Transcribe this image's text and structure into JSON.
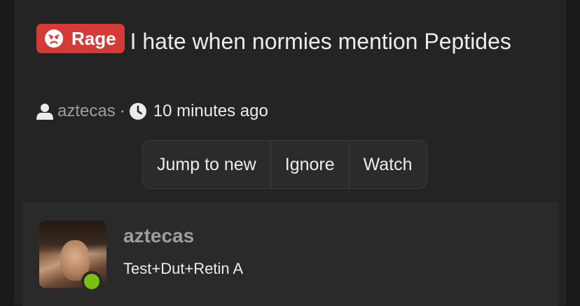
{
  "thread": {
    "prefix_label": "Rage",
    "title": "I hate when normies mention Peptides",
    "author": "aztecas",
    "separator": "·",
    "time": "10 minutes ago"
  },
  "actions": {
    "jump_label": "Jump to new",
    "ignore_label": "Ignore",
    "watch_label": "Watch"
  },
  "post": {
    "username": "aztecas",
    "user_title": "Test+Dut+Retin A",
    "online": true
  },
  "colors": {
    "prefix_badge": "#d53b36",
    "online": "#7bc012",
    "background": "#242424"
  },
  "icons": {
    "prefix": "angry-face-icon",
    "author": "user-icon",
    "time": "clock-icon"
  }
}
